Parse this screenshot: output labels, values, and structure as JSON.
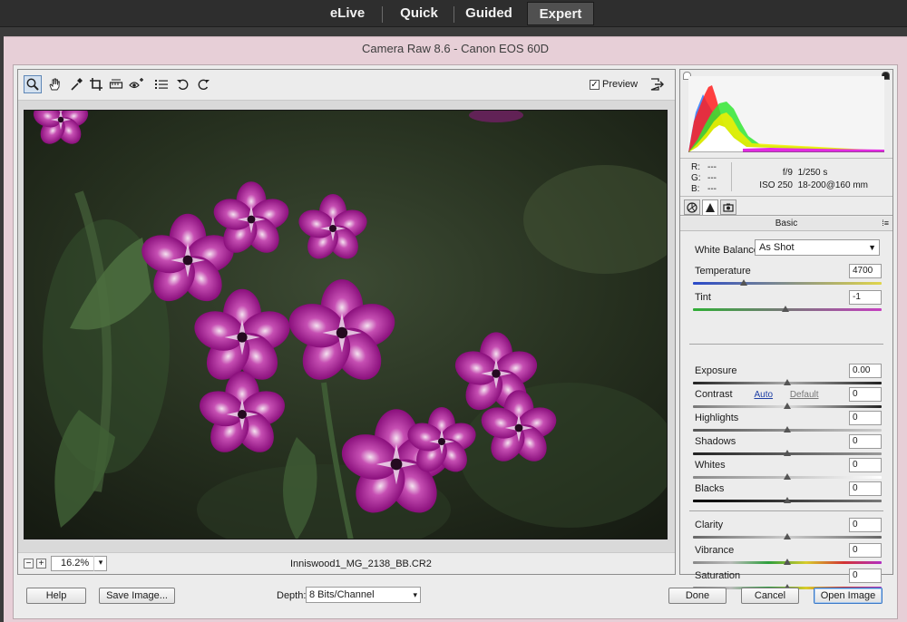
{
  "modes": [
    "eLive",
    "Quick",
    "Guided",
    "Expert"
  ],
  "active_mode": "Expert",
  "dialog": {
    "title": "Camera Raw 8.6  -  Canon EOS 60D"
  },
  "toolbar": {
    "tools": [
      "zoom-tool-icon",
      "hand-tool-icon",
      "white-balance-tool-icon",
      "crop-tool-icon",
      "straighten-tool-icon",
      "red-eye-tool-icon",
      "preferences-icon",
      "rotate-left-icon",
      "rotate-right-icon"
    ],
    "preview_label": "Preview",
    "preview_checked": "✓"
  },
  "zoom": {
    "minus": "−",
    "plus": "+",
    "value": "16.2%",
    "arrow": "▾"
  },
  "file_name": "Inniswood1_MG_2138_BB.CR2",
  "info": {
    "r_label": "R:",
    "r_value": "---",
    "g_label": "G:",
    "g_value": "---",
    "b_label": "B:",
    "b_value": "---",
    "aperture": "f/9",
    "shutter": "1/250 s",
    "iso": "ISO 250",
    "lens": "18-200@160 mm"
  },
  "panel": {
    "section": "Basic",
    "section_menu": "⁞≡",
    "white_balance_label": "White Balance:",
    "white_balance_value": "As Shot",
    "auto_label": "Auto",
    "default_label": "Default"
  },
  "controls": {
    "temperature": {
      "label": "Temperature",
      "value": "4700"
    },
    "tint": {
      "label": "Tint",
      "value": "-1"
    },
    "exposure": {
      "label": "Exposure",
      "value": "0.00"
    },
    "contrast": {
      "label": "Contrast",
      "value": "0"
    },
    "highlights": {
      "label": "Highlights",
      "value": "0"
    },
    "shadows": {
      "label": "Shadows",
      "value": "0"
    },
    "whites": {
      "label": "Whites",
      "value": "0"
    },
    "blacks": {
      "label": "Blacks",
      "value": "0"
    },
    "clarity": {
      "label": "Clarity",
      "value": "0"
    },
    "vibrance": {
      "label": "Vibrance",
      "value": "0"
    },
    "saturation": {
      "label": "Saturation",
      "value": "0"
    }
  },
  "buttons": {
    "help": "Help",
    "save_image": "Save Image...",
    "done": "Done",
    "cancel": "Cancel",
    "open_image": "Open Image"
  },
  "depth": {
    "label": "Depth:",
    "value": "8 Bits/Channel",
    "arrow": "▾"
  },
  "colors": {
    "accent": "#3b79c7",
    "dialog_bg": "#e7cfd7",
    "flower": "#a1188f"
  }
}
